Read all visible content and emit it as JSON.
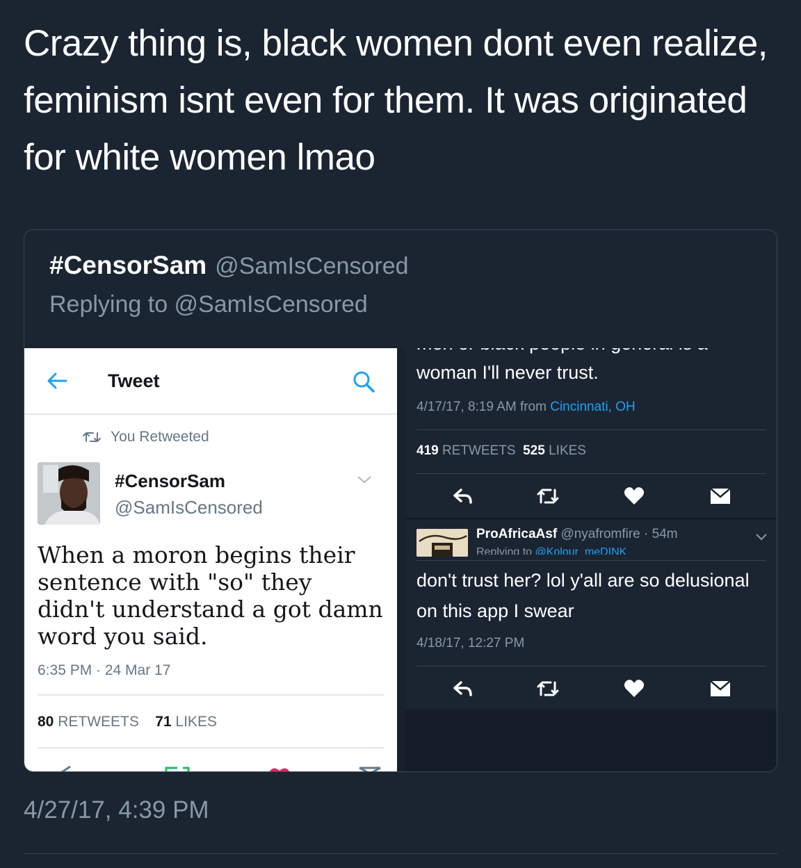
{
  "tweet": {
    "text": "Crazy thing is, black women dont even realize, feminism isnt even for them. It was originated for white women lmao",
    "timestamp": "4/27/17, 4:39 PM"
  },
  "quoted": {
    "name": "#CensorSam",
    "handle": "@SamIsCensored",
    "replying_to": "Replying to @SamIsCensored"
  },
  "left_screenshot": {
    "nav_title": "Tweet",
    "retweeted_label": "You Retweeted",
    "name": "#CensorSam",
    "handle": "@SamIsCensored",
    "body": "When a moron begins their sentence with \"so\" they didn't understand a got damn word you said.",
    "time": "6:35 PM · 24 Mar 17",
    "retweets_count": "80",
    "retweets_label": "RETWEETS",
    "likes_count": "71",
    "likes_label": "LIKES"
  },
  "right_screenshot": {
    "cut_text": "men or black people in general is a",
    "text1": "woman I'll never trust.",
    "meta1_time": "4/17/17, 8:19 AM from",
    "meta1_location": "Cincinnati, OH",
    "retweets_count": "419",
    "retweets_label": "RETWEETS",
    "likes_count": "525",
    "likes_label": "LIKES",
    "reply_name": "ProAfricaAsf",
    "reply_handle_time": "@nyafromfire · 54m",
    "reply_replying_prefix": "Replying to",
    "reply_replying_handle": "@Kolour_meDINK",
    "reply_text": "don't trust her? lol y'all are so delusional on this app I swear",
    "reply_time": "4/18/17, 12:27 PM"
  },
  "colors": {
    "background": "#1b2532",
    "secondary_text": "#8899a6",
    "link": "#1da1f2",
    "like_red": "#e0245e",
    "retweet_green": "#17bf63"
  }
}
